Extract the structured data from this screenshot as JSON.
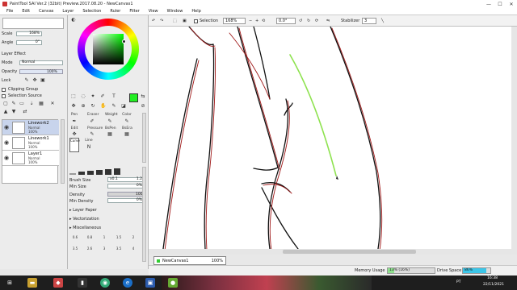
{
  "window": {
    "title": "PaintTool SAI Ver.2 (32bit) Preview.2017.08.20 - NewCanvas1"
  },
  "menu": [
    "File",
    "Edit",
    "Canvas",
    "Layer",
    "Selection",
    "Ruler",
    "Filter",
    "View",
    "Window",
    "Help"
  ],
  "left": {
    "scale_label": "Scale",
    "scale_value": "168%",
    "angle_label": "Angle",
    "angle_value": "0°",
    "layer_effect": "Layer Effect",
    "mode_label": "Mode",
    "mode_value": "Normal",
    "opacity_label": "Opacity",
    "opacity_value": "100%",
    "lock_label": "Lock",
    "clipping_group": "Clipping Group",
    "selection_source": "Selection Source",
    "layers": [
      {
        "name": "Linework2",
        "mode": "Normal",
        "opacity": "100%",
        "selected": true
      },
      {
        "name": "Linework1",
        "mode": "Normal",
        "opacity": "100%",
        "selected": false
      },
      {
        "name": "Layer1",
        "mode": "Normal",
        "opacity": "100%",
        "selected": false
      }
    ]
  },
  "mid": {
    "color_accent": "#22ee22",
    "tool_rows": [
      [
        "Pen",
        "Eraser",
        "Weight",
        "Color"
      ],
      [
        "Edit",
        "Pressure",
        "BsPen",
        "BsEra"
      ]
    ],
    "brush_curve": "Curve",
    "brush_line": "Line",
    "brush_size_label": "Brush Size",
    "brush_size_mult": "x0.1",
    "brush_size_value": "1.2",
    "min_size_label": "Min Size",
    "min_size_value": "0%",
    "density_label": "Density",
    "density_value": "100",
    "min_density_label": "Min Density",
    "min_density_value": "0%",
    "layer_paper": "Layer Paper",
    "vectorization": "Vectorization",
    "miscellaneous": "Miscellaneous",
    "size_presets": [
      "0.6",
      "0.8",
      "1",
      "1.5",
      "2",
      "3.5",
      "2.6",
      "3",
      "3.5",
      "4"
    ]
  },
  "toolbar": {
    "selection_label": "Selection",
    "zoom_value": "168%",
    "angle_value": "0.0°",
    "stabilizer_label": "Stabilizer",
    "stabilizer_value": "3"
  },
  "navigator": {
    "name": "NewCanvas1",
    "zoom": "100%"
  },
  "status": {
    "memory_label": "Memory Usage",
    "memory_value": "13% (16%)",
    "memory_fill": 0.13,
    "drive_label": "Drive Space",
    "drive_value": "86%",
    "drive_fill": 0.86
  },
  "taskbar": {
    "time": "16:38",
    "date": "22/11/2021",
    "lang": "PT"
  }
}
